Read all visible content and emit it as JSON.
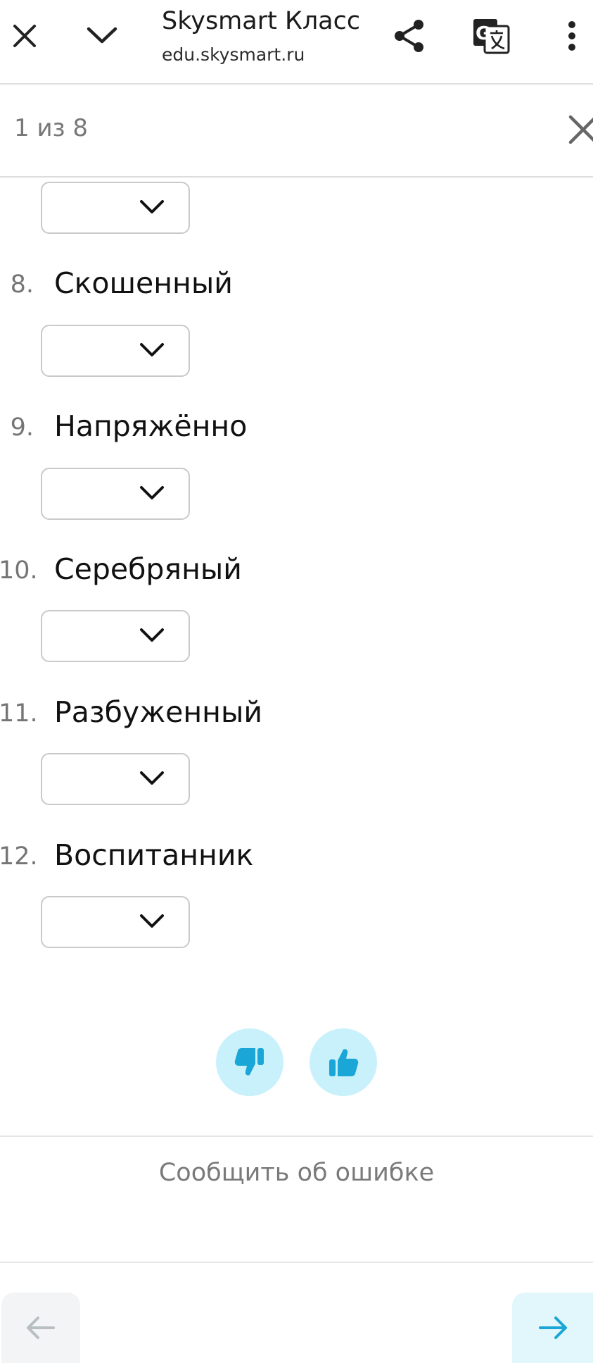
{
  "browser": {
    "title": "Skysmart Класс",
    "url": "edu.skysmart.ru",
    "icons": [
      "close-icon",
      "chevron-down-icon",
      "share-icon",
      "translate-icon",
      "more-vertical-icon"
    ]
  },
  "find": {
    "count": "1 из 8",
    "close_icon": "close-icon"
  },
  "items": [
    {
      "num": "8.",
      "word": "Скошенный"
    },
    {
      "num": "9.",
      "word": "Напряжённо"
    },
    {
      "num": "10.",
      "word": "Серебряный"
    },
    {
      "num": "11.",
      "word": "Разбуженный"
    },
    {
      "num": "12.",
      "word": "Воспитанник"
    }
  ],
  "feedback": {
    "dislike_icon": "thumbs-down-icon",
    "like_icon": "thumbs-up-icon",
    "report_label": "Сообщить об ошибке"
  },
  "nav": {
    "prev_icon": "arrow-left-icon",
    "next_icon": "arrow-right-icon"
  },
  "colors": {
    "accent": "#1aa6d6",
    "feedback_bg": "#c9f1fb",
    "next_bg": "#e2f7fb",
    "disabled": "#b8bfc2"
  }
}
